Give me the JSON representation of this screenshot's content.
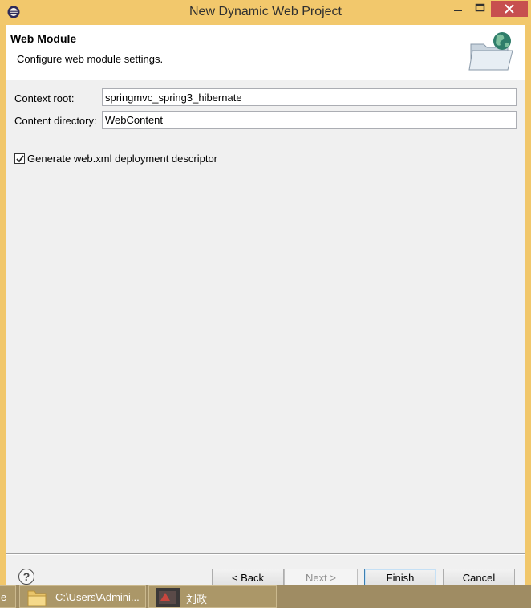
{
  "window": {
    "title": "New Dynamic Web Project",
    "controls": {
      "minimize": "minimize",
      "maximize": "maximize",
      "close": "close"
    }
  },
  "header": {
    "title": "Web Module",
    "description": "Configure web module settings."
  },
  "form": {
    "context_root_label": "Context root:",
    "context_root_value": "springmvc_spring3_hibernate",
    "content_dir_label": "Content directory:",
    "content_dir_value": "WebContent",
    "generate_label": "Generate web.xml deployment descriptor",
    "generate_checked": true
  },
  "footer": {
    "help": "?",
    "back": "< Back",
    "next": "Next >",
    "finish": "Finish",
    "cancel": "Cancel"
  },
  "taskbar": {
    "partial": "e",
    "explorer_label": "C:\\Users\\Admini...",
    "app_label": "刘政"
  },
  "colors": {
    "frame": "#f1c76b",
    "close_button": "#c74f4f",
    "dialog_bg": "#f0f0f0",
    "taskbar": "#9f8c63"
  }
}
